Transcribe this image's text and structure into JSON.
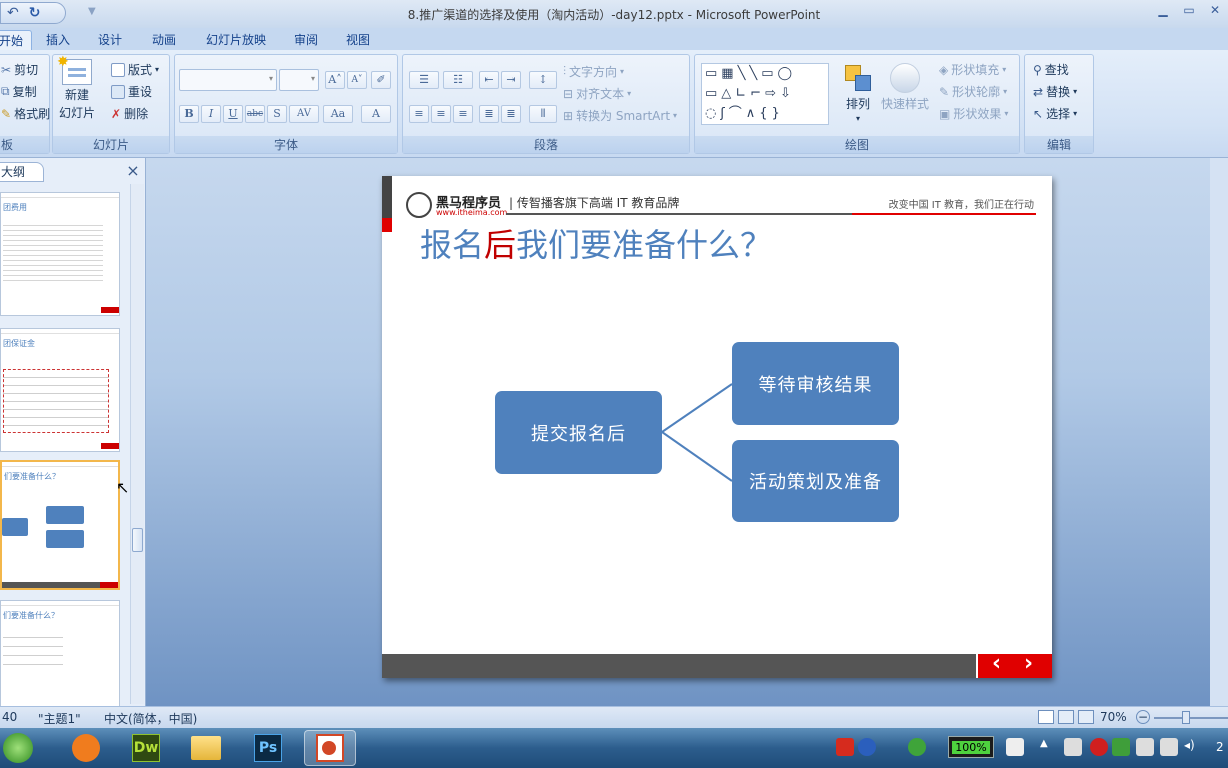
{
  "window": {
    "title": "8.推广渠道的选择及使用（淘内活动）-day12.pptx - Microsoft PowerPoint"
  },
  "tabs": [
    "开始",
    "插入",
    "设计",
    "动画",
    "幻灯片放映",
    "审阅",
    "视图"
  ],
  "ribbon": {
    "clipboard": {
      "cut": "剪切",
      "copy": "复制",
      "format_painter": "格式刷",
      "label": "板"
    },
    "slides": {
      "new_slide_line1": "新建",
      "new_slide_line2": "幻灯片",
      "layout": "版式",
      "reset": "重设",
      "delete": "删除",
      "label": "幻灯片"
    },
    "font": {
      "label": "字体",
      "bold": "B",
      "italic": "I",
      "underline": "U",
      "strike": "abc",
      "shadow": "S",
      "spacing": "AV",
      "case": "Aa",
      "color": "A",
      "grow": "A",
      "shrink": "A"
    },
    "paragraph": {
      "label": "段落",
      "text_direction": "文字方向",
      "align_text": "对齐文本",
      "smartart": "转换为 SmartArt"
    },
    "drawing": {
      "label": "绘图",
      "arrange": "排列",
      "quick_styles": "快速样式",
      "shape_fill": "形状填充",
      "shape_outline": "形状轮廓",
      "shape_effects": "形状效果"
    },
    "editing": {
      "label": "编辑",
      "find": "查找",
      "replace": "替换",
      "select": "选择"
    }
  },
  "panel": {
    "tab_label": "大纲",
    "close": "×",
    "thumbs": [
      {
        "title": "团费用"
      },
      {
        "title": "团保证金"
      },
      {
        "title": "们要准备什么？"
      },
      {
        "title": "们要准备什么？"
      }
    ]
  },
  "slide": {
    "brand_name": "黑马程序员",
    "brand_url": "www.itheima.com",
    "brand_tagline": "| 传智播客旗下高端 IT 教育品牌",
    "header_right": "改变中国 IT 教育，我们正在行动",
    "title_pre": "报名",
    "title_accent": "后",
    "title_post": "我们要准备什么？",
    "node_main": "提交报名后",
    "node_top": "等待审核结果",
    "node_bottom": "活动策划及准备",
    "nav_prev": "‹",
    "nav_next": "›"
  },
  "status": {
    "slide": "40",
    "theme": "\"主题1\"",
    "language": "中文(简体，中国)",
    "zoom": "70%"
  },
  "taskbar": {
    "battery": "100%",
    "clock_fragment": "2"
  },
  "colors": {
    "accent": "#4f81bd",
    "brand_red": "#c00000",
    "title_blue": "#4f81bd"
  }
}
